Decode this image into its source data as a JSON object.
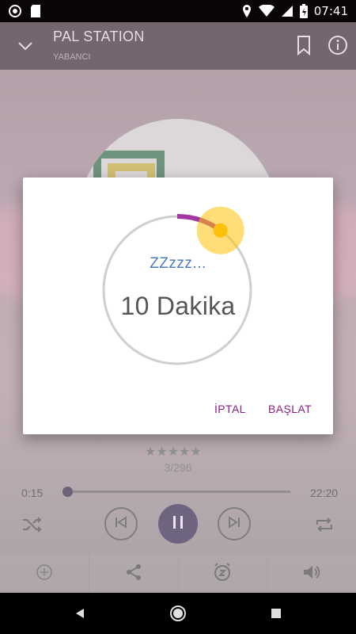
{
  "status_bar": {
    "time": "07:41",
    "icons": [
      "notification-icon",
      "sd-card-icon",
      "location-icon",
      "wifi-icon",
      "signal-icon",
      "battery-icon"
    ]
  },
  "app_bar": {
    "title": "PAL STATION",
    "subtitle": "YABANCI",
    "icons": [
      "chevron-down-icon",
      "bookmark-icon",
      "info-icon"
    ]
  },
  "player": {
    "rating_stars": "★★★★★",
    "track_counter": "3/296",
    "elapsed": "0:15",
    "duration": "22:20",
    "progress": 0.011,
    "controls": [
      "shuffle-icon",
      "previous-icon",
      "pause-icon",
      "next-icon",
      "repeat-icon"
    ]
  },
  "bottom_actions": [
    "add-icon",
    "share-icon",
    "sleep-timer-icon",
    "volume-icon"
  ],
  "sleep_dialog": {
    "zzz_label": "ZZzzz...",
    "duration_label": "10 Dakika",
    "dial_fraction": 0.1,
    "cancel_label": "İPTAL",
    "start_label": "BAŞLAT"
  },
  "nav_bar": {
    "icons": [
      "back-icon",
      "home-icon",
      "recents-icon"
    ]
  },
  "colors": {
    "accent": "#8a1f86",
    "dial_track": "#cfcfcf",
    "dial_thumb": "#ffc107",
    "app_bar": "#2a1322",
    "zzz_text": "#4b7bbf"
  }
}
